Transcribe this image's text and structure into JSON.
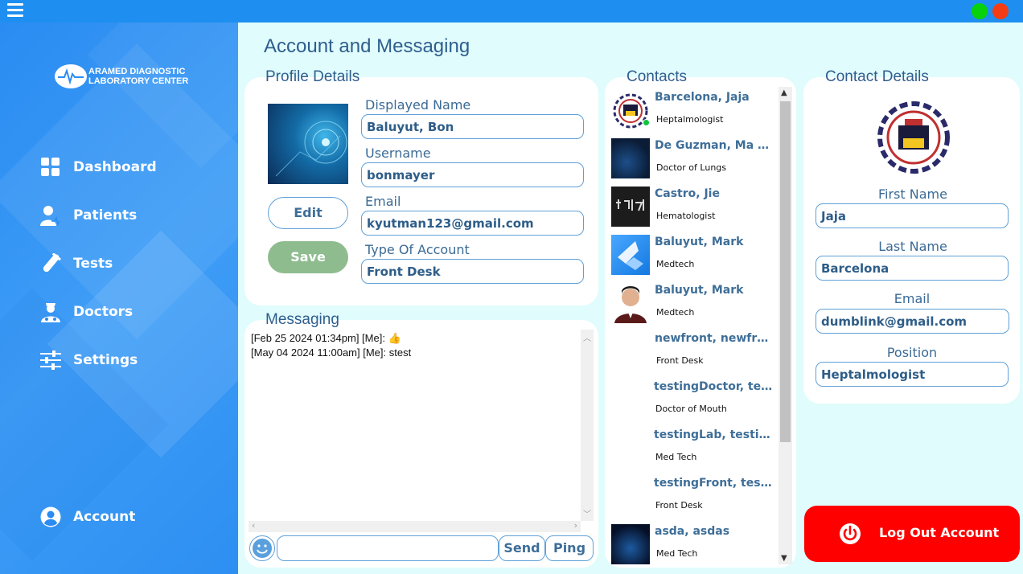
{
  "colors": {
    "accent": "#1e8ff0",
    "logout": "#ff0000",
    "save": "#8fbc8f",
    "online": "#0ec53b"
  },
  "window": {
    "minimize_color": "#08d20c",
    "close_color": "#f63c14"
  },
  "sidebar": {
    "logo_line1": "ARAMED DIAGNOSTIC",
    "logo_line2": "LABORATORY CENTER",
    "items": [
      {
        "label": "Dashboard",
        "icon": "dashboard-icon"
      },
      {
        "label": "Patients",
        "icon": "patient-icon"
      },
      {
        "label": "Tests",
        "icon": "test-tube-icon"
      },
      {
        "label": "Doctors",
        "icon": "doctor-icon"
      },
      {
        "label": "Settings",
        "icon": "settings-sliders-icon"
      }
    ],
    "account": {
      "label": "Account",
      "icon": "user-circle-icon"
    }
  },
  "page_title": "Account and Messaging",
  "profile": {
    "section_label": "Profile Details",
    "displayed_name_label": "Displayed Name",
    "displayed_name": "Baluyut, Bon",
    "username_label": "Username",
    "username": "bonmayer",
    "email_label": "Email",
    "email": "kyutman123@gmail.com",
    "account_type_label": "Type Of Account",
    "account_type": "Front Desk",
    "edit_label": "Edit",
    "save_label": "Save"
  },
  "messaging": {
    "section_label": "Messaging",
    "messages": [
      "[Feb 25 2024 01:34pm] [Me]: 👍",
      "[May 04 2024 11:00am] [Me]: stest"
    ],
    "input_value": "",
    "send_label": "Send",
    "ping_label": "Ping"
  },
  "contacts": {
    "section_label": "Contacts",
    "items": [
      {
        "name": "Barcelona, Jaja",
        "role": "Heptalmologist"
      },
      {
        "name": "De Guzman, Ma Teresa",
        "role": "Doctor of Lungs"
      },
      {
        "name": "Castro, Jie",
        "role": "Hematologist"
      },
      {
        "name": "Baluyut, Mark",
        "role": "Medtech"
      },
      {
        "name": "Baluyut, Mark",
        "role": "Medtech"
      },
      {
        "name": "newfront, newfront",
        "role": "Front Desk"
      },
      {
        "name": "testingDoctor, testingDoctor",
        "role": "Doctor of Mouth"
      },
      {
        "name": "testingLab, testingLab",
        "role": "Med Tech"
      },
      {
        "name": "testingFront, testingFront",
        "role": "Front Desk"
      },
      {
        "name": "asda, asdas",
        "role": "Med Tech"
      }
    ]
  },
  "contact_details": {
    "section_label": "Contact Details",
    "first_name_label": "First Name",
    "first_name": "Jaja",
    "last_name_label": "Last Name",
    "last_name": "Barcelona",
    "email_label": "Email",
    "email": "dumblink@gmail.com",
    "position_label": "Position",
    "position": "Heptalmologist"
  },
  "logout_label": "Log Out Account"
}
